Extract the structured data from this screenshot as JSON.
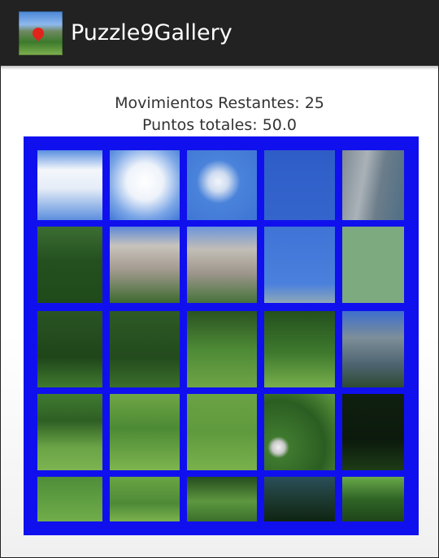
{
  "app": {
    "title": "Puzzle9Gallery",
    "icon": "app-landscape-icon"
  },
  "status": {
    "moves": "Movimientos Restantes: 25",
    "points": "Puntos totales: 50.0"
  },
  "board": {
    "border_color": "#1010ee",
    "rows": 5,
    "cols": 5,
    "tiles": [
      {
        "bg": "linear-gradient(#5a8fe0 0%, #f4f7fb 28%, #e4ecf7 55%, #5b8edd 100%)"
      },
      {
        "bg": "radial-gradient(circle at 50% 45%, #ffffff 0%, #eef3fa 35%, #7aa5e6 70%, #3f77d6 100%)"
      },
      {
        "bg": "radial-gradient(ellipse at 45% 45%, #f2f5fa 0%, #cfdcf0 18%, #4a83da 40%, #3d74d4 100%)"
      },
      {
        "bg": "linear-gradient(#2f5dc8, #3365cc)"
      },
      {
        "bg": "linear-gradient(100deg, #7f8a94 0%, #aab2b8 35%, #6c7d8a 60%, #4d6e86 100%)"
      },
      {
        "bg": "linear-gradient(#3c6e32 0%, #24501f 45%, #1f4a1a 100%)"
      },
      {
        "bg": "linear-gradient(#5c88d6 0%, #c7c3bc 25%, #a59c92 55%, #3d6a2f 100%)"
      },
      {
        "bg": "linear-gradient(#6d95da 0%, #c2beb6 30%, #9f978e 60%, #46733a 100%)"
      },
      {
        "bg": "linear-gradient(#3f73d6 0%, #4b80dd 75%, #8ea8b8 100%)"
      },
      {
        "bg": "#7daa7f"
      },
      {
        "bg": "linear-gradient(#2a5424 0%, #1f451a 60%, #3f7a2f 100%)"
      },
      {
        "bg": "linear-gradient(#2d5a26 0%, #234b1d 60%, #3b6e2c 100%)"
      },
      {
        "bg": "linear-gradient(#2a5322 0%, #4d8a35 50%, #6fa446 100%)"
      },
      {
        "bg": "linear-gradient(#24501d 0%, #3e7a2e 55%, #78ae4c 100%)"
      },
      {
        "bg": "linear-gradient(#3e6fce 0%, #7d8e98 35%, #4d6470 70%, #2e4b33 100%)"
      },
      {
        "bg": "linear-gradient(#3f7a30 0%, #2e5f24 35%, #6aa446 70%, #7db352 100%)"
      },
      {
        "bg": "linear-gradient(#6fa546 0%, #4c8a34 45%, #7db54f 100%)"
      },
      {
        "bg": "linear-gradient(#6aa244 0%, #5f9a3e 50%, #79b14c 100%)"
      },
      {
        "bg": "radial-gradient(circle at 20% 70%, #f2f2f2 0%, #c8c8c8 8%, #3f7a2f 14%, #2b5d22 60%, #5f9a3e 100%)"
      },
      {
        "bg": "linear-gradient(#0f1f10 0%, #0b1a0c 60%, #1d3b16 100%)"
      },
      {
        "bg": "linear-gradient(#4f8e38 0%, #62a043 60%, #71ad4b 100%)"
      },
      {
        "bg": "linear-gradient(#69a444 0%, #4e8a36 60%, #7bb24e 100%)"
      },
      {
        "bg": "linear-gradient(#254d1e 0%, #5d973f 55%, #3a6f2c 100%)"
      },
      {
        "bg": "linear-gradient(#2a4f5a 0%, #1d3a32 50%, #0f2412 100%)"
      },
      {
        "bg": "linear-gradient(#6aa94a 0%, #2f6526 50%, #1e4419 100%)"
      }
    ]
  }
}
